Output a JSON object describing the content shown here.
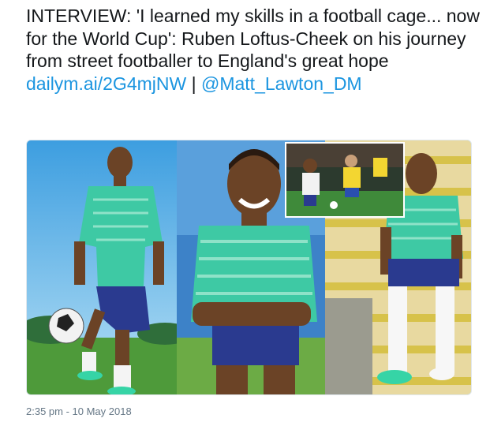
{
  "tweet": {
    "text": "INTERVIEW: 'I learned my skills in a football cage... now for the World Cup': Ruben Loftus-Cheek on his journey from street footballer to England's great hope",
    "link": "dailym.ai/2G4mjNW",
    "separator": "|",
    "mention": "@Matt_Lawton_DM"
  },
  "timestamp": "2:35 pm - 10 May 2018"
}
